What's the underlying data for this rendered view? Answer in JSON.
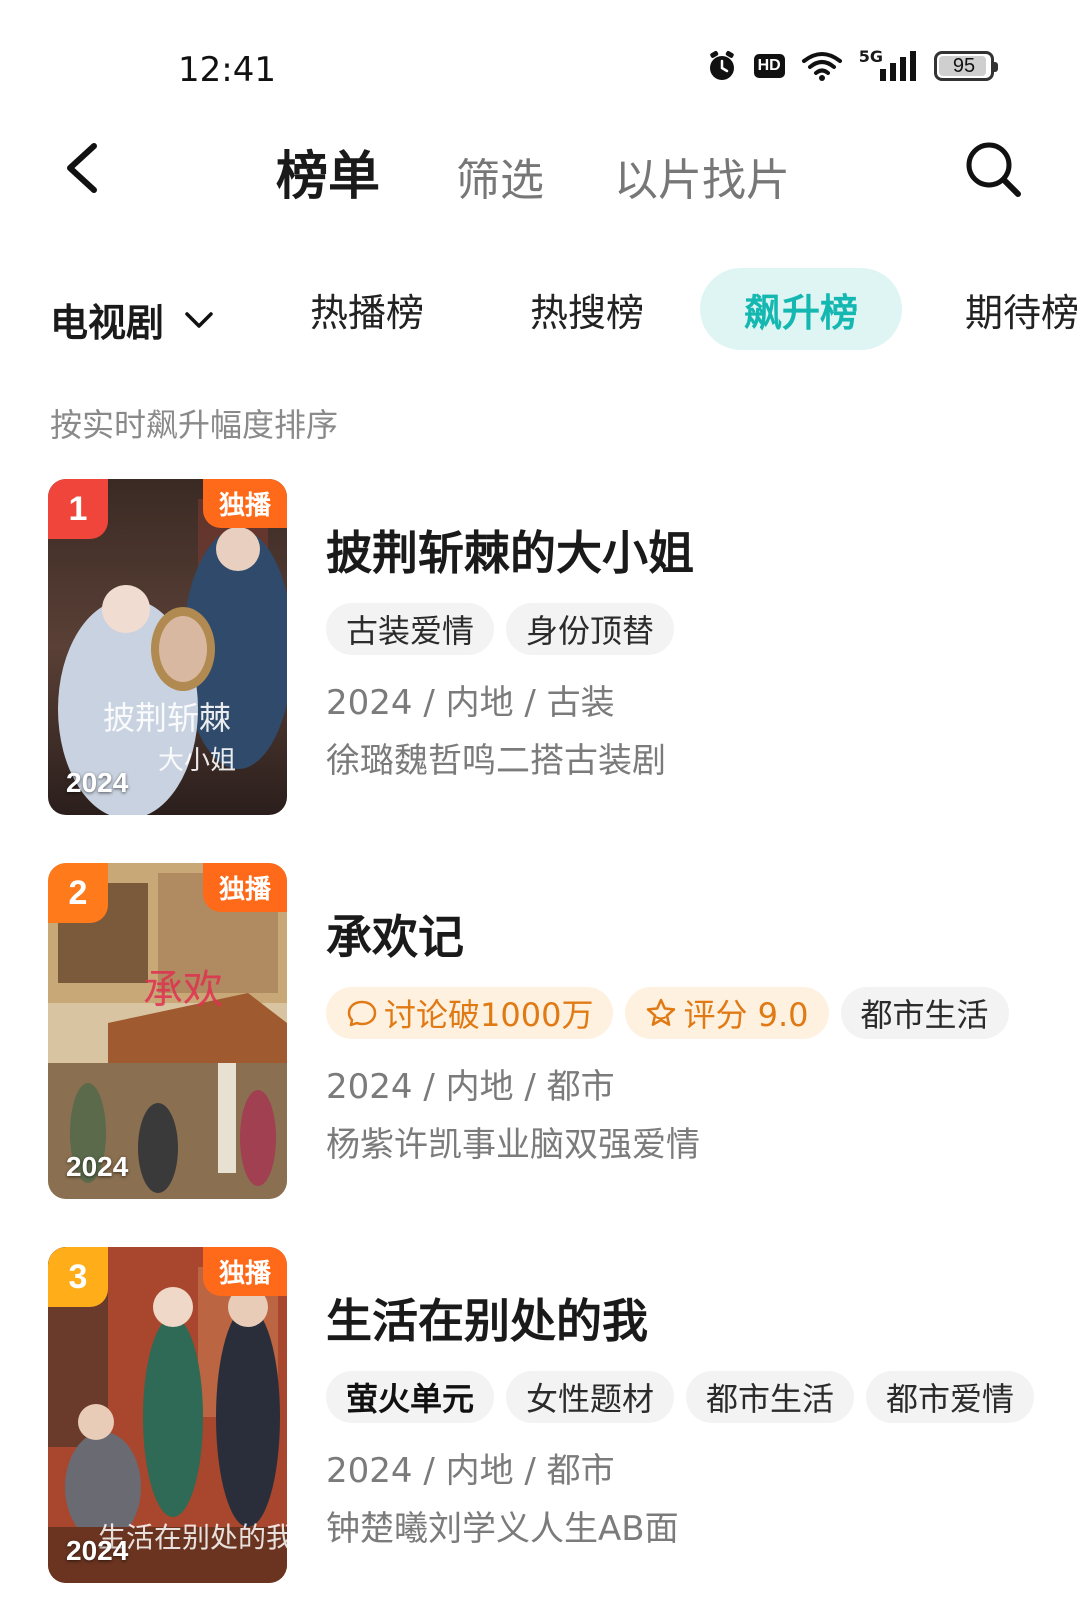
{
  "status": {
    "time": "12:41",
    "hd": "HD",
    "net": "5G",
    "battery": "95",
    "battery_level": 0.95
  },
  "header": {
    "tab_main": "榜单",
    "tab_filter": "筛选",
    "tab_find": "以片找片"
  },
  "category": {
    "selected": "电视剧",
    "tabs": [
      {
        "label": "热播榜",
        "active": false
      },
      {
        "label": "热搜榜",
        "active": false
      },
      {
        "label": "飙升榜",
        "active": true
      },
      {
        "label": "期待榜",
        "active": false
      }
    ]
  },
  "sort_note": "按实时飙升幅度排序",
  "items": [
    {
      "rank": "1",
      "badge": "独播",
      "year": "2024",
      "title": "披荆斩棘的大小姐",
      "tags": [
        "古装爱情",
        "身份顶替"
      ],
      "meta": "2024 / 内地 / 古装",
      "desc": "徐璐魏哲鸣二搭古装剧",
      "rank_color": "#f0453a"
    },
    {
      "rank": "2",
      "badge": "独播",
      "year": "2024",
      "title": "承欢记",
      "tags": [
        "讨论破1000万",
        "评分 9.0",
        "都市生活"
      ],
      "meta": "2024 / 内地 / 都市",
      "desc": "杨紫许凯事业脑双强爱情",
      "rank_color": "#ff7a1a"
    },
    {
      "rank": "3",
      "badge": "独播",
      "year": "2024",
      "title": "生活在别处的我",
      "tags": [
        "萤火单元",
        "女性题材",
        "都市生活",
        "都市爱情"
      ],
      "meta": "2024 / 内地 / 都市",
      "desc": "钟楚曦刘学义人生AB面",
      "rank_color": "#ffae1a"
    }
  ]
}
